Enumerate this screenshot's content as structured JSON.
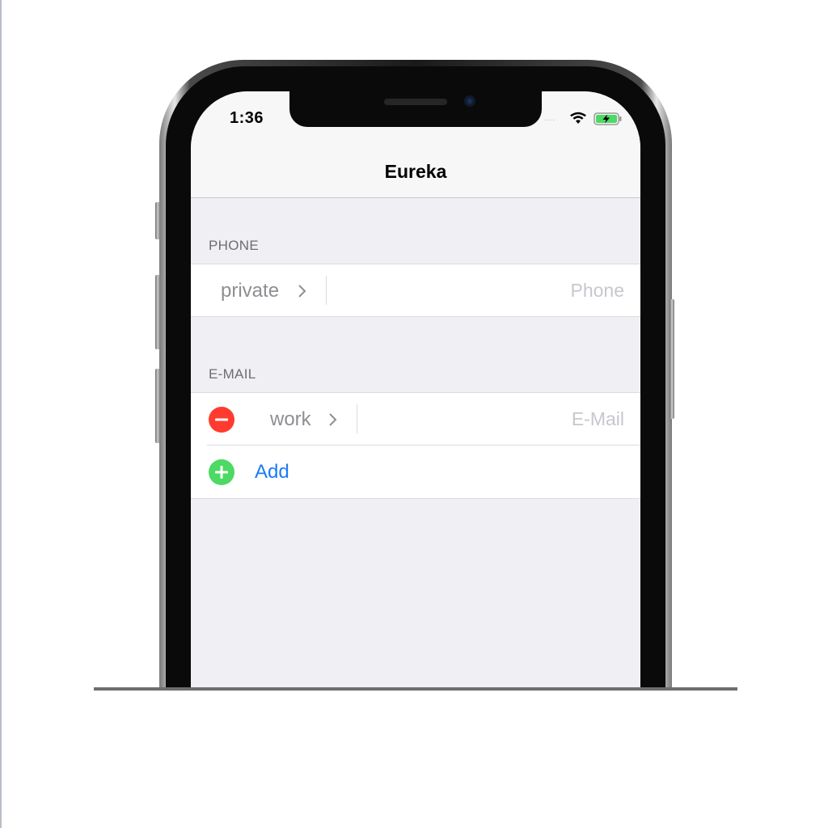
{
  "status_bar": {
    "time": "1:36",
    "signal": "....",
    "wifi_icon": "wifi-icon",
    "battery_icon": "battery-charging-icon",
    "battery_color": "#4cd964"
  },
  "nav": {
    "title": "Eureka"
  },
  "sections": {
    "phone": {
      "header": "PHONE",
      "row": {
        "label": "private",
        "placeholder": "Phone"
      }
    },
    "email": {
      "header": "E-MAIL",
      "row": {
        "label": "work",
        "placeholder": "E-Mail",
        "delete_icon": "minus-circle-icon"
      },
      "add": {
        "label": "Add",
        "icon": "plus-circle-icon"
      }
    }
  },
  "colors": {
    "accent": "#1a7cf5",
    "delete": "#ff3b30",
    "add": "#4cd964",
    "background": "#efeff4"
  }
}
